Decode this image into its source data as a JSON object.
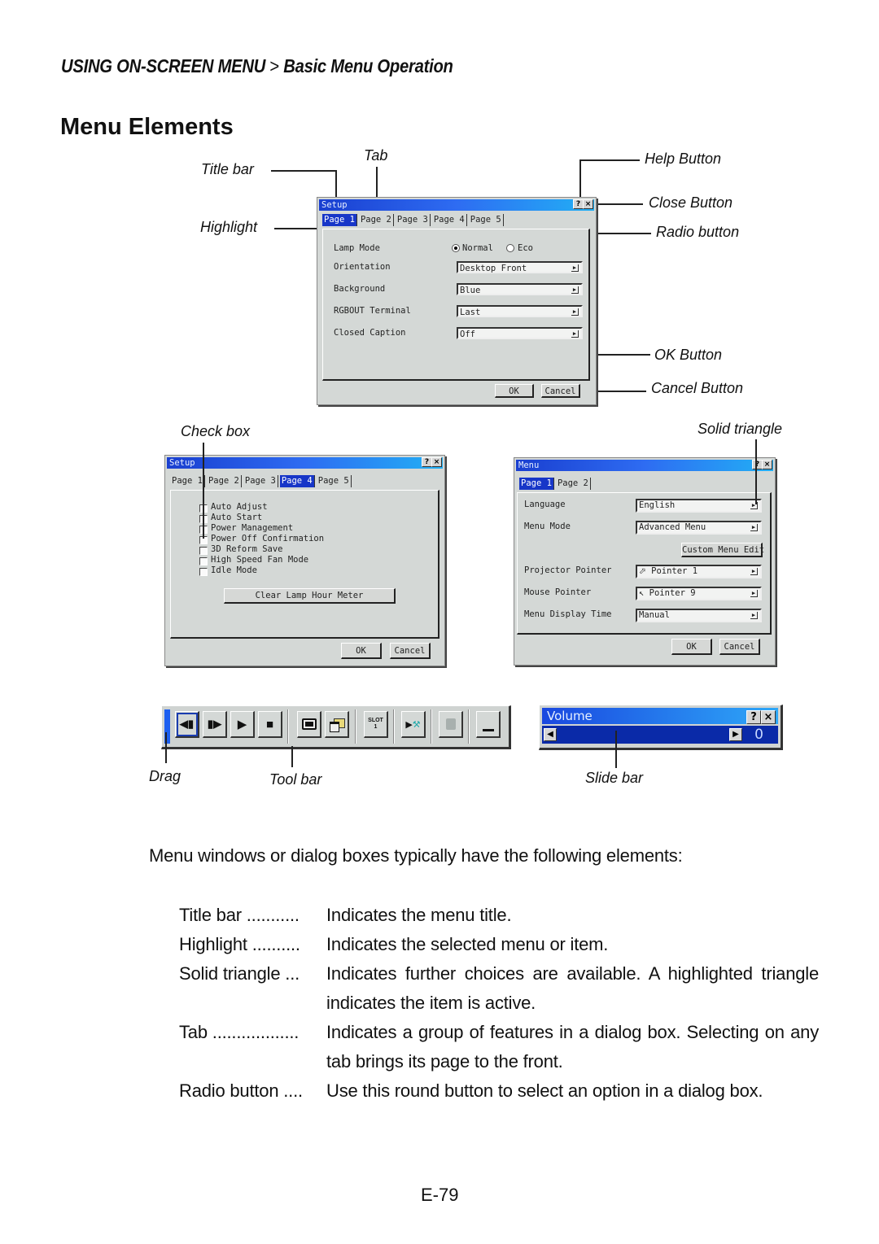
{
  "header": {
    "section": "USING ON-SCREEN MENU",
    "separator": ">",
    "subsection": "Basic Menu Operation"
  },
  "page_title": "Menu Elements",
  "callouts": {
    "title_bar": "Title bar",
    "tab": "Tab",
    "highlight": "Highlight",
    "help_button": "Help Button",
    "close_button": "Close Button",
    "radio_button": "Radio button",
    "ok_button": "OK Button",
    "cancel_button": "Cancel Button",
    "check_box": "Check box",
    "solid_triangle": "Solid triangle",
    "drag": "Drag",
    "tool_bar": "Tool bar",
    "slide_bar": "Slide bar"
  },
  "setup_page1": {
    "title": "Setup",
    "help": "?",
    "close": "×",
    "tabs": [
      "Page 1",
      "Page 2",
      "Page 3",
      "Page 4",
      "Page 5"
    ],
    "active_tab": "Page 1",
    "lamp_mode_label": "Lamp Mode",
    "radio_options": [
      {
        "label": "Normal",
        "selected": true
      },
      {
        "label": "Eco",
        "selected": false
      }
    ],
    "rows": [
      {
        "label": "Orientation",
        "value": "Desktop Front"
      },
      {
        "label": "Background",
        "value": "Blue"
      },
      {
        "label": "RGBOUT Terminal",
        "value": "Last"
      },
      {
        "label": "Closed Caption",
        "value": "Off"
      }
    ],
    "ok": "OK",
    "cancel": "Cancel"
  },
  "setup_page4": {
    "title": "Setup",
    "help": "?",
    "close": "×",
    "tabs": [
      "Page 1",
      "Page 2",
      "Page 3",
      "Page 4",
      "Page 5"
    ],
    "active_tab": "Page 4",
    "checkboxes": [
      {
        "label": "Auto Adjust",
        "checked": false
      },
      {
        "label": "Auto Start",
        "checked": false
      },
      {
        "label": "Power Management",
        "checked": false
      },
      {
        "label": "Power Off Confirmation",
        "checked": false
      },
      {
        "label": "3D Reform Save",
        "checked": false
      },
      {
        "label": "High Speed Fan Mode",
        "checked": false
      },
      {
        "label": "Idle Mode",
        "checked": false
      }
    ],
    "clear_button": "Clear Lamp Hour Meter",
    "ok": "OK",
    "cancel": "Cancel"
  },
  "menu_dialog": {
    "title": "Menu",
    "help": "?",
    "close": "×",
    "tabs": [
      "Page 1",
      "Page 2"
    ],
    "active_tab": "Page 1",
    "rows": [
      {
        "label": "Language",
        "value": "English"
      },
      {
        "label": "Menu Mode",
        "value": "Advanced Menu"
      },
      {
        "label": "Projector Pointer",
        "value": "Pointer 1"
      },
      {
        "label": "Mouse Pointer",
        "value": "Pointer 9"
      },
      {
        "label": "Menu Display Time",
        "value": "Manual"
      }
    ],
    "custom_edit": "Custom Menu Edit",
    "ok": "OK",
    "cancel": "Cancel"
  },
  "toolbar": {
    "tools": [
      {
        "icon": "frame-back-icon",
        "glyph": "◀▍"
      },
      {
        "icon": "frame-forward-icon",
        "glyph": "▍▶"
      },
      {
        "icon": "play-icon",
        "glyph": "▶"
      },
      {
        "icon": "stop-icon",
        "glyph": "■"
      },
      {
        "icon": "window-icon",
        "glyph": "▭"
      },
      {
        "icon": "folder-window-icon",
        "glyph": "⧉"
      },
      {
        "icon": "slot-icon",
        "glyph": "SLOT\n1"
      },
      {
        "icon": "pointer-tool-icon",
        "glyph": "▶⚒"
      },
      {
        "icon": "trash-icon",
        "glyph": "🗑"
      },
      {
        "icon": "minimize-icon",
        "glyph": "▁"
      }
    ]
  },
  "volume": {
    "title": "Volume",
    "help": "?",
    "close": "×",
    "value": "0"
  },
  "body": {
    "intro": "Menu windows or dialog boxes typically have the following elements:",
    "definitions": [
      {
        "term": "Title bar ...........",
        "desc": "Indicates the menu title."
      },
      {
        "term": "Highlight ..........",
        "desc": "Indicates the selected menu or item."
      },
      {
        "term": "Solid triangle ...",
        "desc": "Indicates further choices are available. A highlighted triangle indicates the item is active."
      },
      {
        "term": "Tab ..................",
        "desc": "Indicates a group of features in a dialog box. Selecting on any tab brings its page to the front."
      },
      {
        "term": "Radio button ....",
        "desc": "Use this round button to select an option in a dialog box."
      }
    ]
  },
  "page_number": "E-79"
}
